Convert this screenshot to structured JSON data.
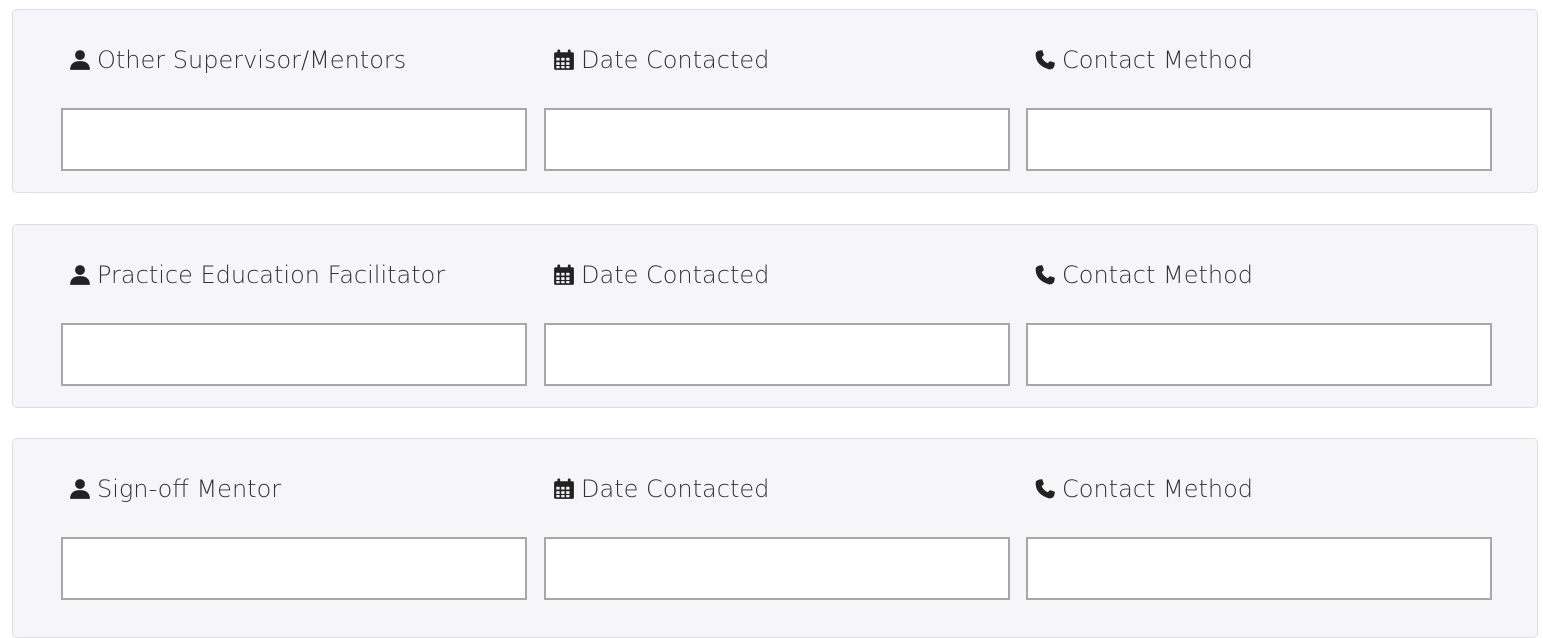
{
  "rows": [
    {
      "name_label": "Other Supervisor/Mentors",
      "date_label": "Date Contacted",
      "method_label": "Contact Method",
      "name_value": "",
      "date_value": "",
      "method_value": ""
    },
    {
      "name_label": "Practice Education Facilitator",
      "date_label": "Date Contacted",
      "method_label": "Contact Method",
      "name_value": "",
      "date_value": "",
      "method_value": ""
    },
    {
      "name_label": "Sign-off Mentor",
      "date_label": "Date Contacted",
      "method_label": "Contact Method",
      "name_value": "",
      "date_value": "",
      "method_value": ""
    }
  ],
  "icons": {
    "person": "user-icon",
    "calendar": "calendar-icon",
    "phone": "phone-icon"
  }
}
